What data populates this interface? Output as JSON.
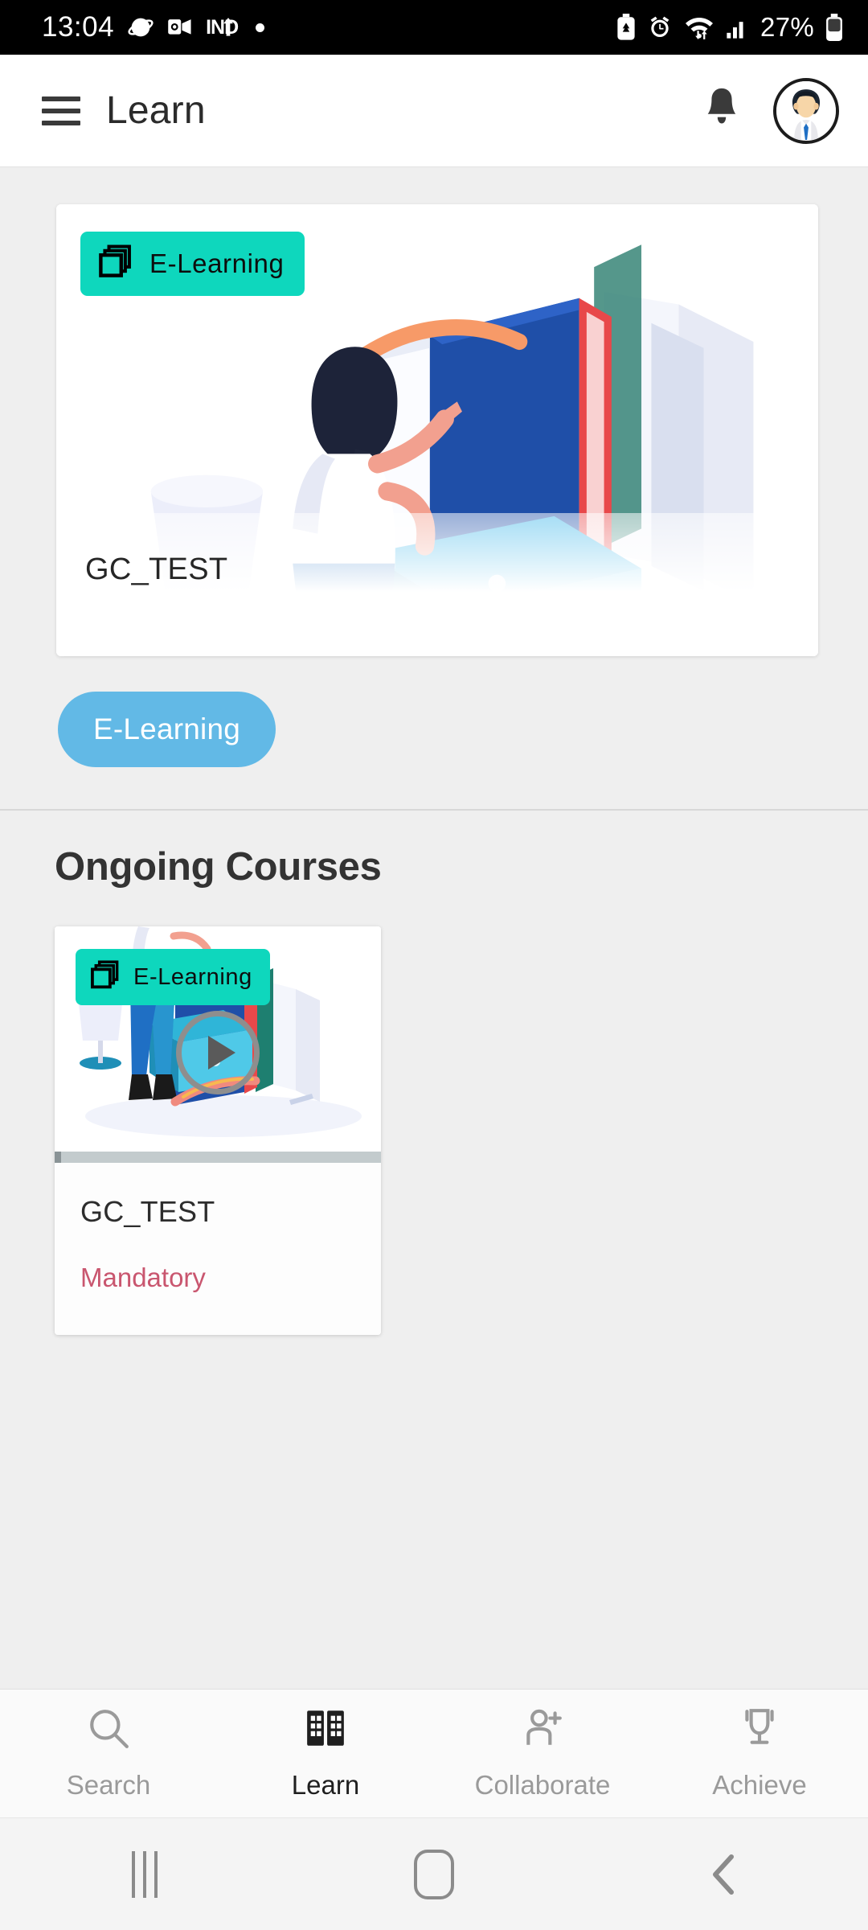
{
  "status_bar": {
    "time": "13:04",
    "battery_percent": "27%",
    "carrier_label": "IND",
    "left_icons": [
      "samsung-internet-icon",
      "outlook-icon",
      "network-upload-icon",
      "notification-dot-icon"
    ],
    "right_icons": [
      "battery-saver-icon",
      "alarm-icon",
      "wifi-icon",
      "signal-bars-icon",
      "battery-icon"
    ]
  },
  "app_bar": {
    "title": "Learn",
    "menu_icon": "hamburger-menu-icon",
    "notification_icon": "bell-icon",
    "avatar_icon": "user-avatar-icon"
  },
  "featured": {
    "badge_label": "E-Learning",
    "badge_icon": "stacked-layers-icon",
    "badge_color": "#0ed7bd",
    "course_title": "GC_TEST",
    "illustration": "woman-reading-books-illustration"
  },
  "filter_chip": {
    "label": "E-Learning",
    "color": "#62b9e6"
  },
  "ongoing_section": {
    "heading": "Ongoing Courses",
    "courses": [
      {
        "badge_label": "E-Learning",
        "badge_icon": "stacked-layers-icon",
        "play_icon": "play-circle-icon",
        "progress_percent": 2,
        "name": "GC_TEST",
        "tag": "Mandatory",
        "tag_color": "#c9566f"
      }
    ]
  },
  "bottom_nav": {
    "items": [
      {
        "label": "Search",
        "icon": "search-icon",
        "active": false
      },
      {
        "label": "Learn",
        "icon": "book-icon",
        "active": true
      },
      {
        "label": "Collaborate",
        "icon": "person-add-icon",
        "active": false
      },
      {
        "label": "Achieve",
        "icon": "trophy-icon",
        "active": false
      }
    ]
  },
  "system_nav": {
    "recents_icon": "recents-icon",
    "home_icon": "home-icon",
    "back_icon": "back-icon"
  }
}
